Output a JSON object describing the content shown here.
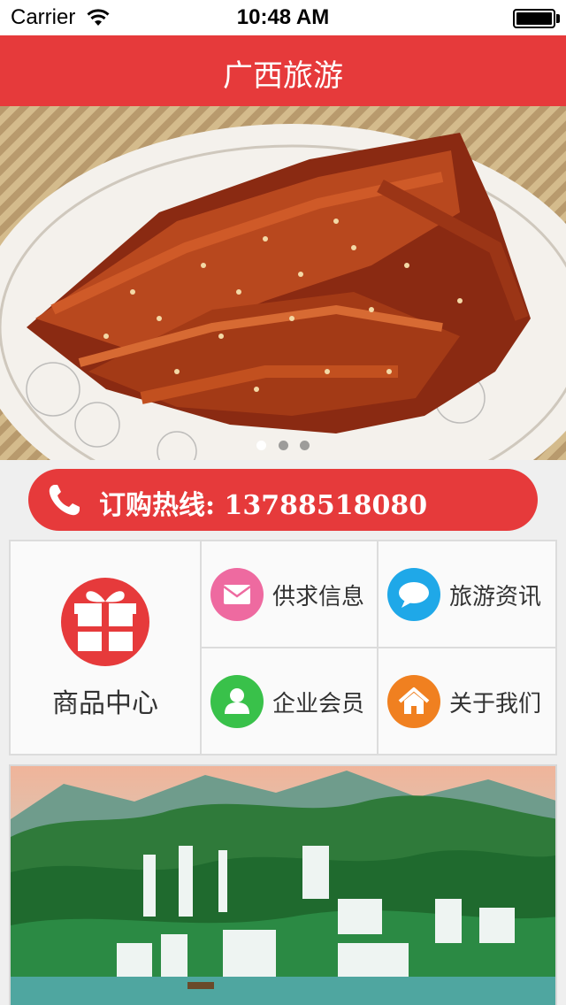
{
  "status_bar": {
    "carrier": "Carrier",
    "time": "10:48 AM"
  },
  "nav": {
    "title": "广西旅游"
  },
  "hero": {
    "image": "spicy-fried-fish-dish-photo",
    "slide_count": 3,
    "active_slide": 1
  },
  "hotline": {
    "icon": "phone-icon",
    "text": "订购热线: 13788518080"
  },
  "menu": {
    "featured": {
      "label": "商品中心",
      "icon": "gift-icon",
      "color": "#e63a3b"
    },
    "items": [
      {
        "label": "供求信息",
        "icon": "mail-icon",
        "color": "#ee6aa0"
      },
      {
        "label": "旅游资讯",
        "icon": "chat-bubble-icon",
        "color": "#1fa8e8"
      },
      {
        "label": "企业会员",
        "icon": "user-icon",
        "color": "#39c14a"
      },
      {
        "label": "关于我们",
        "icon": "home-icon",
        "color": "#f08020"
      }
    ]
  },
  "bottom_banner": {
    "image": "waterfall-landscape-photo"
  },
  "colors": {
    "brand_red": "#e63a3b",
    "background": "#efefef"
  }
}
